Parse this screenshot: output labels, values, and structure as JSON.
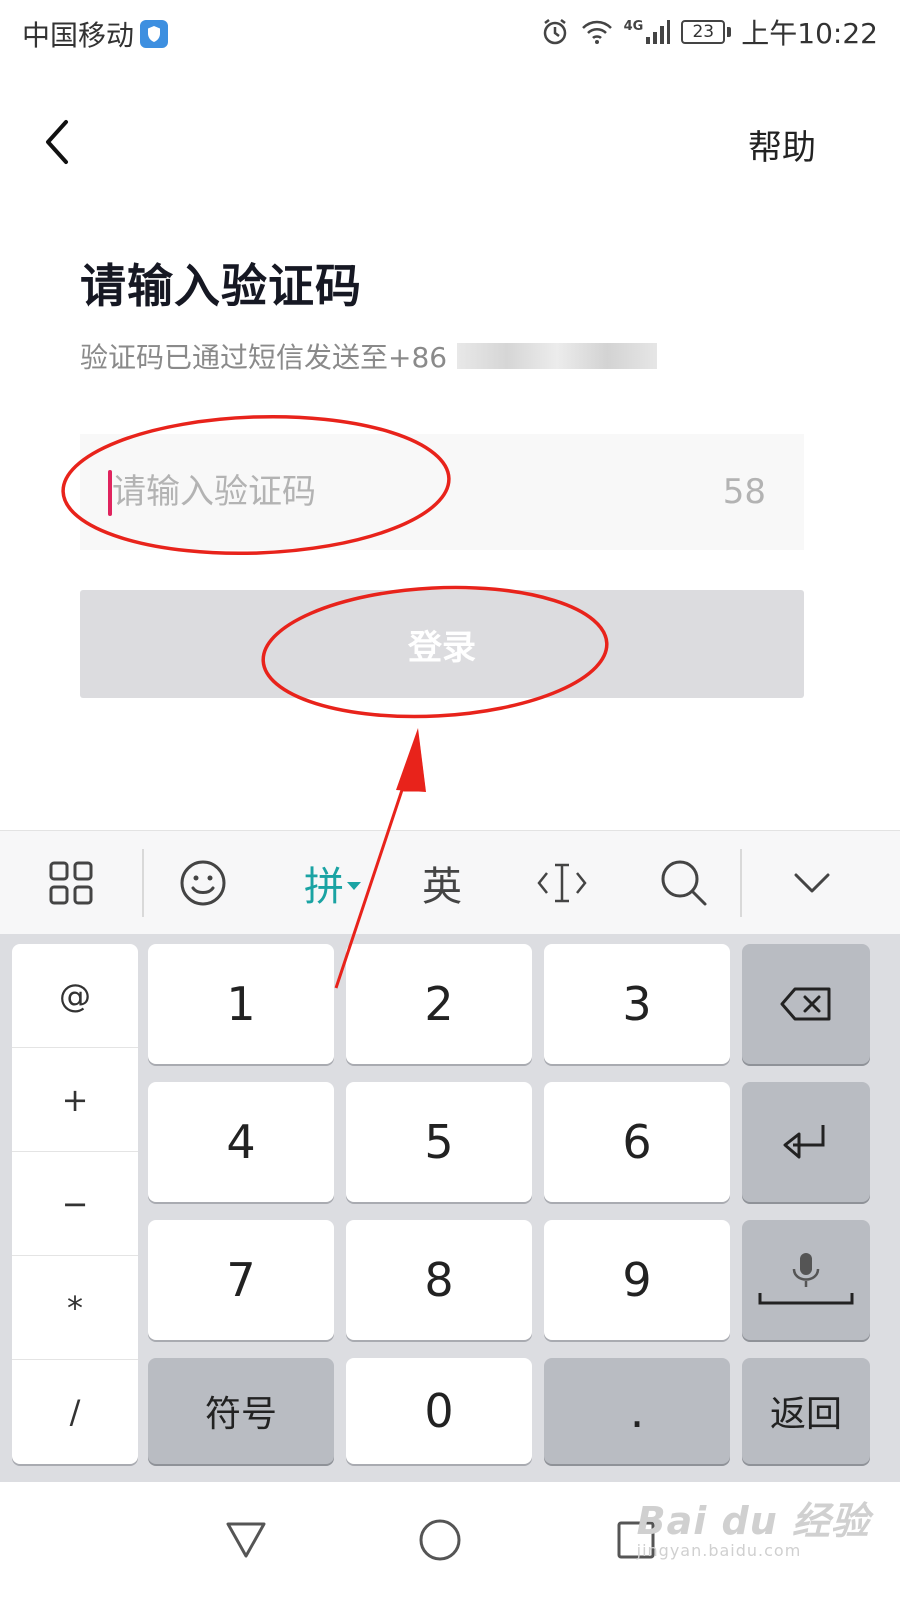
{
  "status_bar": {
    "carrier": "中国移动",
    "network": "4G",
    "battery": "23",
    "time": "上午10:22"
  },
  "header": {
    "help_label": "帮助"
  },
  "main": {
    "title": "请输入验证码",
    "subtitle": "验证码已通过短信发送至+86",
    "code_placeholder": "请输入验证码",
    "countdown": "58",
    "login_label": "登录"
  },
  "keyboard_toolbar": {
    "pinyin_label": "拼",
    "english_label": "英"
  },
  "keyboard": {
    "symbols": [
      "@",
      "+",
      "−",
      "*",
      "/"
    ],
    "digits": [
      "1",
      "2",
      "3",
      "4",
      "5",
      "6",
      "7",
      "8",
      "9"
    ],
    "symbols_key": "符号",
    "zero": "0",
    "dot": ".",
    "back_key": "返回"
  },
  "watermark": {
    "brand": "Bai du 经验",
    "url": "jingyan.baidu.com"
  },
  "colors": {
    "caret": "#e0245e",
    "pinyin_accent": "#1aa3a3",
    "annotation_red": "#e8231b",
    "login_disabled_bg": "#dcdcdf"
  }
}
